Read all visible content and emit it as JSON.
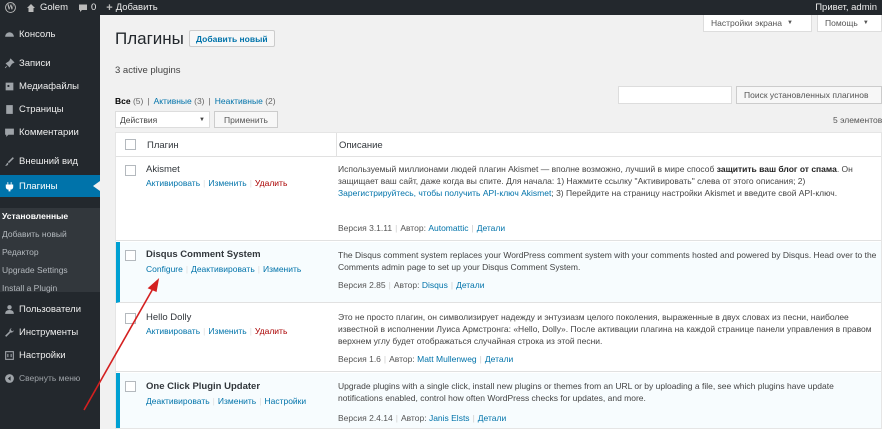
{
  "adminbar": {
    "site_name": "Golem",
    "comments_count": "0",
    "new_label": "Добавить",
    "greeting": "Привет, admin"
  },
  "sidebar": {
    "items": [
      {
        "label": "Консоль",
        "icon": "dashboard-icon"
      },
      {
        "label": "Записи",
        "icon": "pin-icon"
      },
      {
        "label": "Медиафайлы",
        "icon": "media-icon"
      },
      {
        "label": "Страницы",
        "icon": "page-icon"
      },
      {
        "label": "Комментарии",
        "icon": "comment-icon"
      },
      {
        "label": "Внешний вид",
        "icon": "brush-icon"
      },
      {
        "label": "Плагины",
        "icon": "plug-icon"
      },
      {
        "label": "Пользователи",
        "icon": "users-icon"
      },
      {
        "label": "Инструменты",
        "icon": "wrench-icon"
      },
      {
        "label": "Настройки",
        "icon": "settings-icon"
      }
    ],
    "submenu": [
      "Установленные",
      "Добавить новый",
      "Редактор",
      "Upgrade Settings",
      "Install a Plugin"
    ],
    "collapse_label": "Свернуть меню"
  },
  "screen_options": "Настройки экрана",
  "help": "Помощь",
  "page_title": "Плагины",
  "add_new": "Добавить новый",
  "active_count": "3 active plugins",
  "filters": {
    "all": "Все",
    "all_count": "(5)",
    "active": "Активные",
    "active_count": "(3)",
    "inactive": "Неактивные",
    "inactive_count": "(2)"
  },
  "search_button": "Поиск установленных плагинов",
  "bulk_action": "Действия",
  "apply": "Применить",
  "items_count": "5 элементов",
  "table": {
    "col_plugin": "Плагин",
    "col_desc": "Описание"
  },
  "plugins": [
    {
      "name": "Akismet",
      "actions": [
        "Активировать",
        "Изменить",
        "Удалить"
      ],
      "desc_1": "Используемый миллионами людей плагин Akismet — вполне возможно, лучший в мире способ ",
      "desc_bold": "защитить ваш блог от спама",
      "desc_2": ". Он защищает ваш сайт, даже когда вы спите. Для начала: 1) Нажмите ссылку \"Активировать\" слева от этого описания; 2) ",
      "desc_link": "Зарегистрируйтесь, чтобы получить API-ключ Akismet",
      "desc_3": "; 3) Перейдите на страницу настройки Akismet и введите свой API-ключ.",
      "version": "Версия 3.1.11",
      "author_label": "Автор:",
      "author": "Automattic",
      "details": "Детали"
    },
    {
      "name": "Disqus Comment System",
      "actions": [
        "Configure",
        "Деактивировать",
        "Изменить"
      ],
      "desc": "The Disqus comment system replaces your WordPress comment system with your comments hosted and powered by Disqus. Head over to the Comments admin page to set up your Disqus Comment System.",
      "version": "Версия 2.85",
      "author_label": "Автор:",
      "author": "Disqus",
      "details": "Детали"
    },
    {
      "name": "Hello Dolly",
      "actions": [
        "Активировать",
        "Изменить",
        "Удалить"
      ],
      "desc": "Это не просто плагин, он символизирует надежду и энтузиазм целого поколения, выраженные в двух словах из песни, наиболее известной в исполнении Луиса Армстронга: «Hello, Dolly». После активации плагина на каждой странице панели управления в правом верхнем углу будет отображаться случайная строка из этой песни.",
      "version": "Версия 1.6",
      "author_label": "Автор:",
      "author": "Matt Mullenweg",
      "details": "Детали"
    },
    {
      "name": "One Click Plugin Updater",
      "actions": [
        "Деактивировать",
        "Изменить",
        "Настройки"
      ],
      "desc": "Upgrade plugins with a single click, install new plugins or themes from an URL or by uploading a file, see which plugins have update notifications enabled, control how often WordPress checks for updates, and more.",
      "version": "Версия 2.4.14",
      "author_label": "Автор:",
      "author": "Janis Elsts",
      "details": "Детали"
    }
  ]
}
